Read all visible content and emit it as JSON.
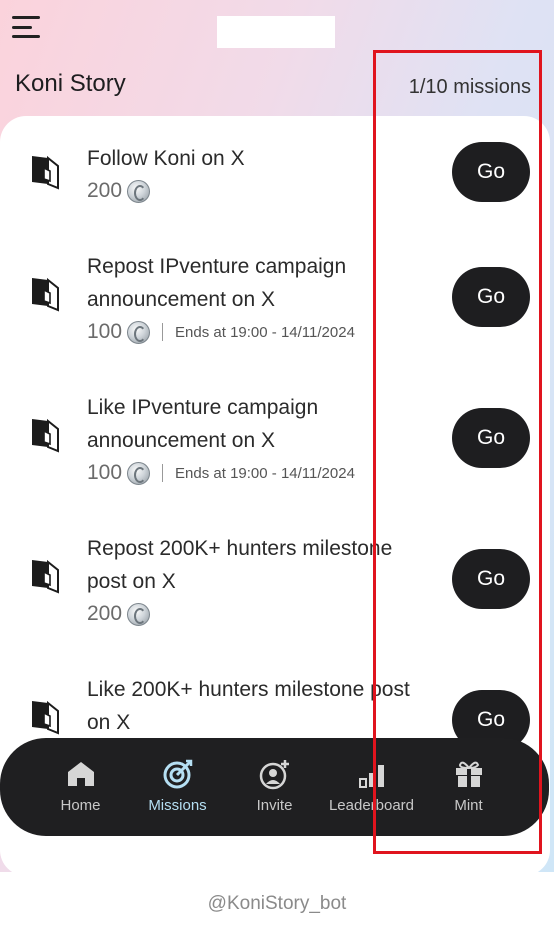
{
  "header": {
    "title": "Koni Story",
    "progress": "1/10 missions"
  },
  "missions": [
    {
      "title_line1": "Follow Koni on X",
      "title_line2": "",
      "points": "200",
      "ends": "",
      "go_label": "Go"
    },
    {
      "title_line1": "Repost IPventure campaign",
      "title_line2": "announcement on X",
      "points": "100",
      "ends": "Ends at 19:00 - 14/11/2024",
      "go_label": "Go"
    },
    {
      "title_line1": "Like IPventure campaign",
      "title_line2": "announcement on X",
      "points": "100",
      "ends": "Ends at 19:00 - 14/11/2024",
      "go_label": "Go"
    },
    {
      "title_line1": "Repost 200K+ hunters milestone",
      "title_line2": "post on X",
      "points": "200",
      "ends": "",
      "go_label": "Go"
    },
    {
      "title_line1": "Like 200K+ hunters milestone post",
      "title_line2": "on X",
      "points": "",
      "ends": "",
      "go_label": "Go"
    }
  ],
  "nav": {
    "items": [
      {
        "label": "Home",
        "icon": "home-icon"
      },
      {
        "label": "Missions",
        "icon": "target-icon"
      },
      {
        "label": "Invite",
        "icon": "add-user-icon"
      },
      {
        "label": "Leaderboard",
        "icon": "bar-chart-icon"
      },
      {
        "label": "Mint",
        "icon": "gift-icon"
      }
    ]
  },
  "footer": {
    "bot_handle": "@KoniStory_bot"
  },
  "colors": {
    "button_bg": "#1e1e20",
    "active_nav": "#b5dff3",
    "annotation_box": "#e0141e"
  }
}
